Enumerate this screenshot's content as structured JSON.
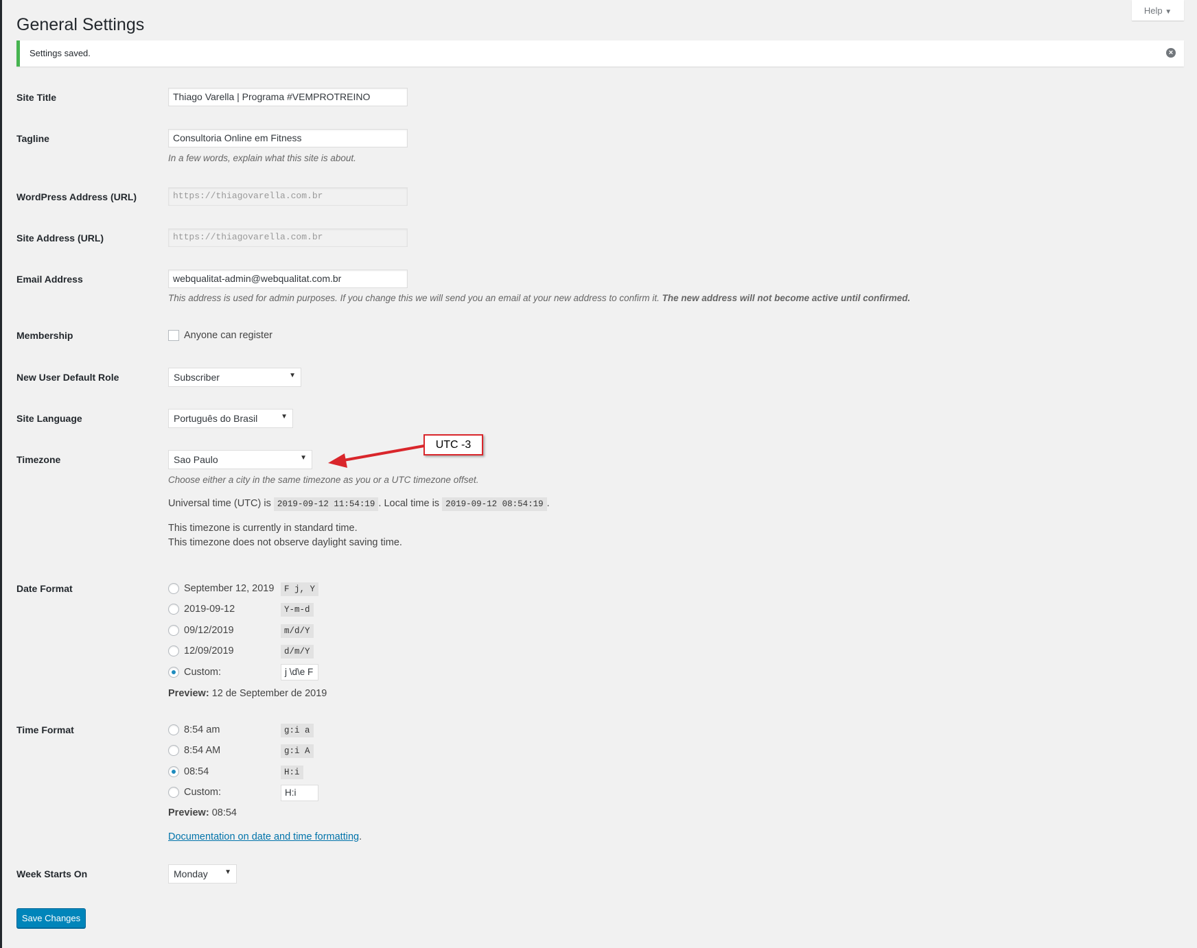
{
  "page_title": "General Settings",
  "help_label": "Help",
  "notice": "Settings saved.",
  "fields": {
    "site_title": {
      "label": "Site Title",
      "value": "Thiago Varella | Programa #VEMPROTREINO"
    },
    "tagline": {
      "label": "Tagline",
      "value": "Consultoria Online em Fitness",
      "description": "In a few words, explain what this site is about."
    },
    "wp_address": {
      "label": "WordPress Address (URL)",
      "value": "https://thiagovarella.com.br"
    },
    "site_address": {
      "label": "Site Address (URL)",
      "value": "https://thiagovarella.com.br"
    },
    "email": {
      "label": "Email Address",
      "value": "webqualitat-admin@webqualitat.com.br",
      "description": "This address is used for admin purposes. If you change this we will send you an email at your new address to confirm it.",
      "description_bold": "The new address will not become active until confirmed."
    },
    "membership": {
      "label": "Membership",
      "checkbox_label": "Anyone can register",
      "checked": false
    },
    "default_role": {
      "label": "New User Default Role",
      "value": "Subscriber"
    },
    "language": {
      "label": "Site Language",
      "value": "Português do Brasil"
    },
    "timezone": {
      "label": "Timezone",
      "value": "Sao Paulo",
      "description": "Choose either a city in the same timezone as you or a UTC timezone offset.",
      "utc_prefix": "Universal time (UTC) is",
      "utc_time": "2019-09-12 11:54:19",
      "local_prefix": ". Local time is",
      "local_time": "2019-09-12 08:54:19",
      "local_suffix": ".",
      "standard_note": "This timezone is currently in standard time.",
      "dst_note": "This timezone does not observe daylight saving time."
    },
    "date_format": {
      "label": "Date Format",
      "options": [
        {
          "label": "September 12, 2019",
          "code": "F j, Y",
          "checked": false
        },
        {
          "label": "2019-09-12",
          "code": "Y-m-d",
          "checked": false
        },
        {
          "label": "09/12/2019",
          "code": "m/d/Y",
          "checked": false
        },
        {
          "label": "12/09/2019",
          "code": "d/m/Y",
          "checked": false
        }
      ],
      "custom_label": "Custom:",
      "custom_value": "j \\d\\e F",
      "custom_checked": true,
      "preview_label": "Preview:",
      "preview_value": "12 de September de 2019"
    },
    "time_format": {
      "label": "Time Format",
      "options": [
        {
          "label": "8:54 am",
          "code": "g:i a",
          "checked": false
        },
        {
          "label": "8:54 AM",
          "code": "g:i A",
          "checked": false
        },
        {
          "label": "08:54",
          "code": "H:i",
          "checked": true
        }
      ],
      "custom_label": "Custom:",
      "custom_value": "H:i",
      "custom_checked": false,
      "preview_label": "Preview:",
      "preview_value": "08:54",
      "doc_link": "Documentation on date and time formatting",
      "doc_suffix": "."
    },
    "week_start": {
      "label": "Week Starts On",
      "value": "Monday"
    }
  },
  "save_label": "Save Changes",
  "annotation": {
    "text": "UTC -3",
    "color": "#d9262b"
  }
}
